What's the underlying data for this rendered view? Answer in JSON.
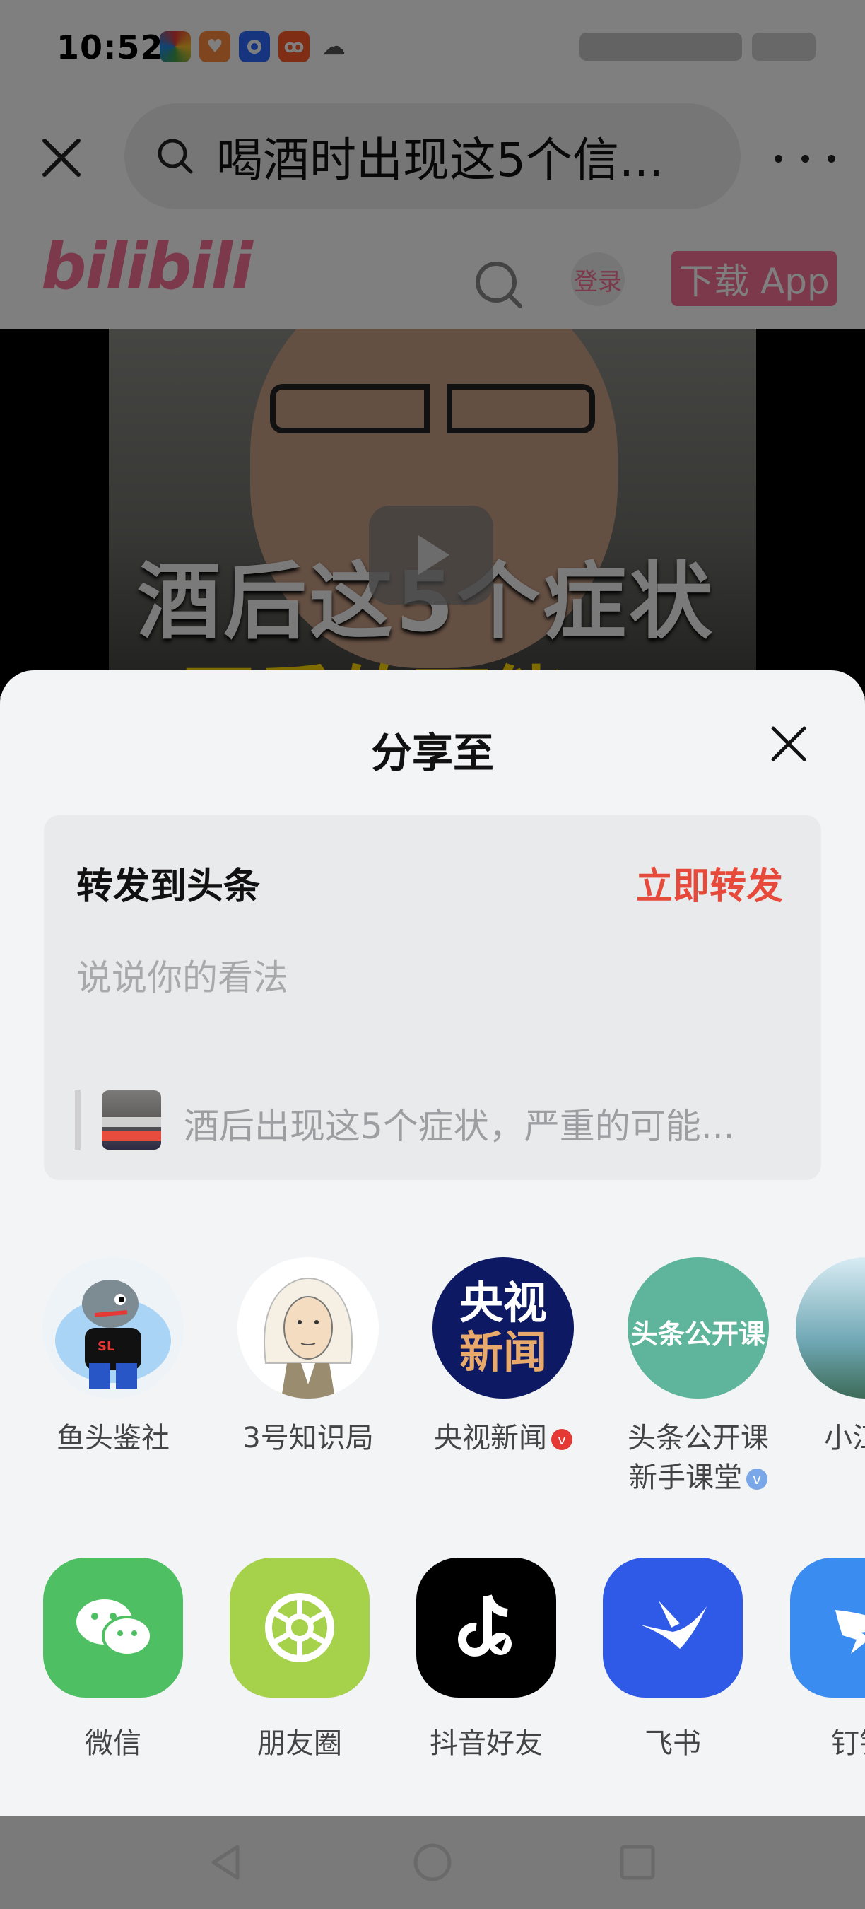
{
  "status_bar": {
    "time": "10:52",
    "apps": [
      {
        "icon": "colorful-app-icon",
        "color": "#4caf50",
        "glyph": "◐"
      },
      {
        "icon": "heart-app-icon",
        "color": "#ff8a3d",
        "glyph": "♥"
      },
      {
        "icon": "blue-app-icon",
        "color": "#2f6bff",
        "glyph": "●"
      },
      {
        "icon": "kuaishou-icon",
        "color": "#ff5a2b",
        "glyph": "8"
      },
      {
        "icon": "wechat-status-icon",
        "color": "#ffffff",
        "glyph": "✉"
      }
    ]
  },
  "browser": {
    "search_text": "喝酒时出现这5个信...",
    "close_icon": "close-icon",
    "more_icon": "more-icon"
  },
  "site_header": {
    "logo": "bilibili",
    "login_label": "登录",
    "download_label": "下载 App",
    "brand_color": "#fb7299"
  },
  "video": {
    "caption_line1": "酒后这5个症状",
    "caption_line2": "严重的可能"
  },
  "share_sheet": {
    "title": "分享至",
    "repost": {
      "title": "转发到头条",
      "action_label": "立即转发",
      "action_color": "#e7493b",
      "input_placeholder": "说说你的看法",
      "quote_text": "酒后出现这5个症状，严重的可能..."
    },
    "contacts": [
      {
        "name": "鱼头鉴社",
        "badge": ""
      },
      {
        "name": "3号知识局",
        "badge": ""
      },
      {
        "name": "央视新闻",
        "badge": "v",
        "badge_color": "#e53935",
        "avatar_text_top": "央视",
        "avatar_text_bottom": "新闻"
      },
      {
        "name_line1": "头条公开课",
        "name_line2": "新手课堂",
        "badge": "v",
        "badge_color": "#7aa7e8",
        "avatar_text": "头条公开课"
      },
      {
        "name": "小江"
      }
    ],
    "apps": [
      {
        "label": "微信",
        "color": "#4fbf63",
        "icon": "wechat-icon"
      },
      {
        "label": "朋友圈",
        "color": "#a6d14a",
        "icon": "moments-icon"
      },
      {
        "label": "抖音好友",
        "color": "#000000",
        "icon": "douyin-icon"
      },
      {
        "label": "飞书",
        "color": "#2f5ae8",
        "icon": "feishu-icon"
      },
      {
        "label": "钉钉",
        "color": "#3a8cf0",
        "icon": "dingtalk-icon"
      }
    ]
  }
}
